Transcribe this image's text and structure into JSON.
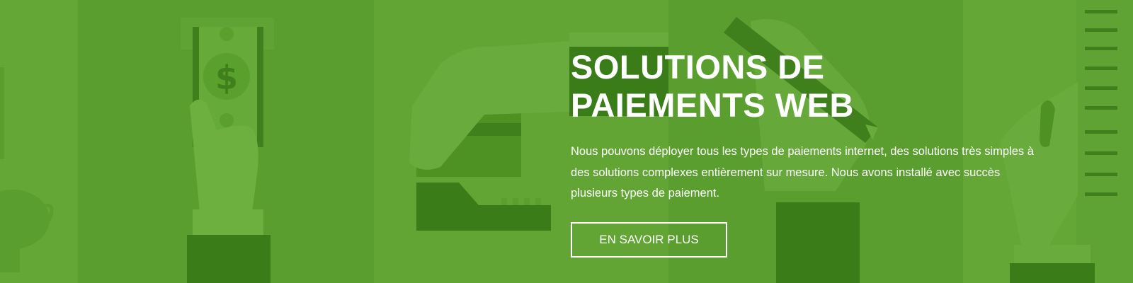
{
  "hero": {
    "title": "SOLUTIONS DE PAIEMENTS WEB",
    "text": "Nous pouvons déployer tous les types de paiements internet, des solutions très simples à des solutions complexes entièrement sur mesure. Nous avons installé avec succès plusieurs types de paiement.",
    "button_label": "EN SAVOIR PLUS"
  },
  "illustration": {
    "currency_symbol": "$",
    "icons": [
      "piggy-bank-icon",
      "banknote-icon",
      "credit-card-icon",
      "pen-icon",
      "ruler-icon"
    ]
  },
  "colors": {
    "background": "#5a9e2f",
    "panel_light": "#64a736",
    "panel_dark": "#3e7f1a",
    "illustration_light": "#6aab3d",
    "illustration_dark": "#3a7d18",
    "text": "#ffffff"
  }
}
